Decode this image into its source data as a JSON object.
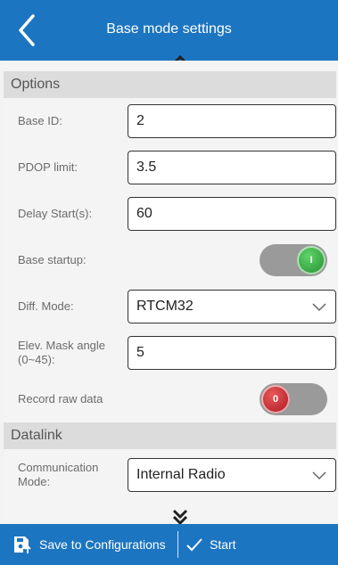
{
  "header": {
    "title": "Base mode settings",
    "back_icon": "chevron-left-icon",
    "color": "#1c75c1"
  },
  "sections": {
    "options": "Options",
    "datalink": "Datalink"
  },
  "fields": {
    "base_id": {
      "label": "Base ID:",
      "value": "2"
    },
    "pdop_limit": {
      "label": "PDOP limit:",
      "value": "3.5"
    },
    "delay_start": {
      "label": "Delay Start(s):",
      "value": "60"
    },
    "base_startup": {
      "label": "Base startup:",
      "state": "on",
      "knob_text": "I",
      "color": "#1f8c2b"
    },
    "diff_mode": {
      "label": "Diff. Mode:",
      "value": "RTCM32"
    },
    "elev_mask": {
      "label_line1": "Elev. Mask angle",
      "label_line2": "(0~45):",
      "value": "5"
    },
    "record_raw": {
      "label": "Record raw data",
      "state": "off",
      "knob_text": "0",
      "color": "#a8121c"
    },
    "comm_mode": {
      "label_line1": "Communication",
      "label_line2": "Mode:",
      "value": "Internal Radio"
    }
  },
  "footer": {
    "save_label": "Save to Configurations",
    "start_label": "Start"
  }
}
